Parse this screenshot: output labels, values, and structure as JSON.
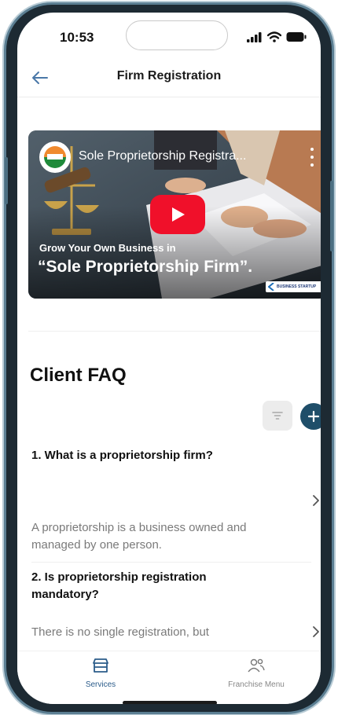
{
  "status_bar": {
    "time": "10:53"
  },
  "header": {
    "title": "Firm Registration"
  },
  "video": {
    "title": "Sole Proprietorship Registra...",
    "subtitle": "Grow Your Own Business in",
    "headline": "“Sole Proprietorship Firm”.",
    "logo_text": "BUSINESS STARTUP"
  },
  "faq_section": {
    "title": "Client FAQ"
  },
  "faqs": [
    {
      "question": "1. What is a proprietorship firm?",
      "answer_line1": "A proprietorship is a business owned and",
      "answer_line2": "managed by one person."
    },
    {
      "question_line1": "2. Is proprietorship registration",
      "question_line2": "mandatory?",
      "answer_line1": "There is no single registration, but"
    }
  ],
  "bottom_nav": {
    "items": [
      {
        "label": "Services",
        "icon": "store-icon",
        "active": true
      },
      {
        "label": "Franchise Menu",
        "icon": "people-icon",
        "active": false
      }
    ]
  },
  "colors": {
    "accent": "#1f4e69",
    "active_nav": "#2b5c8a",
    "play_button": "#f0102a"
  }
}
